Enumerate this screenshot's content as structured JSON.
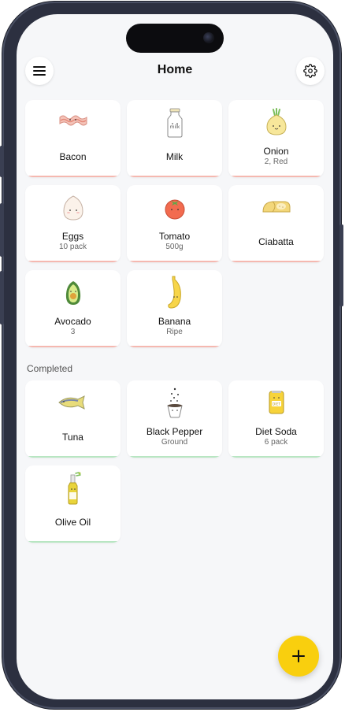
{
  "header": {
    "title": "Home",
    "menu_icon": "hamburger-menu-icon",
    "settings_icon": "gear-icon"
  },
  "colors": {
    "pending_bar": "#f5b8b0",
    "completed_bar": "#b8e6c2",
    "fab": "#f9cf0e",
    "background": "#f6f7f9"
  },
  "pending_items": [
    {
      "name": "Bacon",
      "detail": "",
      "icon": "bacon-icon"
    },
    {
      "name": "Milk",
      "detail": "",
      "icon": "milk-bottle-icon"
    },
    {
      "name": "Onion",
      "detail": "2, Red",
      "icon": "onion-icon"
    },
    {
      "name": "Eggs",
      "detail": "10 pack",
      "icon": "egg-icon"
    },
    {
      "name": "Tomato",
      "detail": "500g",
      "icon": "tomato-icon"
    },
    {
      "name": "Ciabatta",
      "detail": "",
      "icon": "bread-icon"
    },
    {
      "name": "Avocado",
      "detail": "3",
      "icon": "avocado-icon"
    },
    {
      "name": "Banana",
      "detail": "Ripe",
      "icon": "banana-icon"
    }
  ],
  "completed_section": {
    "label": "Completed"
  },
  "completed_items": [
    {
      "name": "Tuna",
      "detail": "",
      "icon": "fish-icon"
    },
    {
      "name": "Black Pepper",
      "detail": "Ground",
      "icon": "pepper-pot-icon"
    },
    {
      "name": "Diet Soda",
      "detail": "6 pack",
      "icon": "soda-can-icon"
    },
    {
      "name": "Olive Oil",
      "detail": "",
      "icon": "olive-oil-bottle-icon"
    }
  ],
  "fab": {
    "icon": "plus-icon"
  },
  "icons": {
    "milk_label": "milk",
    "soda_label": "DIET"
  }
}
